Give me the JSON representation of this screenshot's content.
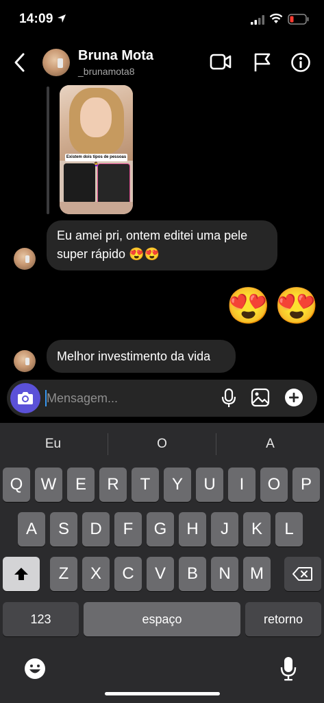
{
  "status_bar": {
    "time": "14:09"
  },
  "header": {
    "name": "Bruna Mota",
    "handle": "_brunamota8"
  },
  "story_reply": {
    "caption": "Existem dois tipos de pessoas 🤷‍♀️"
  },
  "messages": [
    {
      "line1": "Eu amei pri, ontem editei uma pele",
      "line2": "super rápido 😍😍"
    },
    {
      "text": "😍😍"
    },
    {
      "text": "Melhor investimento da vida"
    }
  ],
  "composer": {
    "placeholder": "Mensagem..."
  },
  "keyboard": {
    "suggestions": [
      "Eu",
      "O",
      "A"
    ],
    "row1": [
      "Q",
      "W",
      "E",
      "R",
      "T",
      "Y",
      "U",
      "I",
      "O",
      "P"
    ],
    "row2": [
      "A",
      "S",
      "D",
      "F",
      "G",
      "H",
      "J",
      "K",
      "L"
    ],
    "row3": [
      "Z",
      "X",
      "C",
      "V",
      "B",
      "N",
      "M"
    ],
    "numbers_key": "123",
    "space_key": "espaço",
    "return_key": "retorno"
  }
}
